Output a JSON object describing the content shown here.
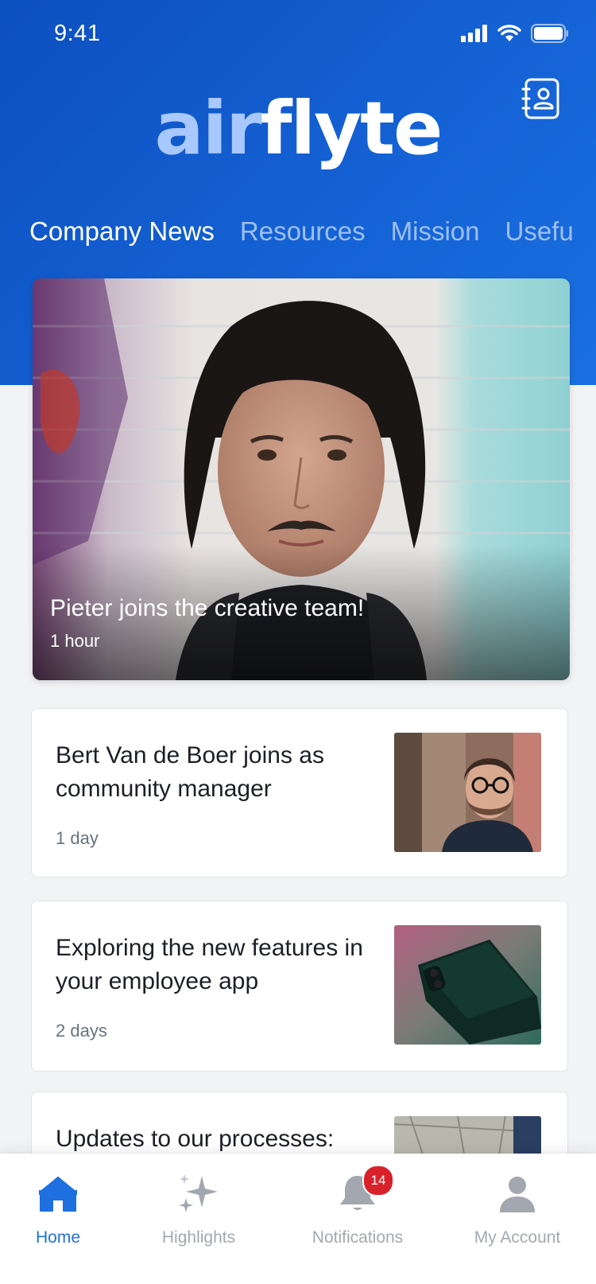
{
  "status_bar": {
    "time": "9:41"
  },
  "header": {
    "logo_part1": "air",
    "logo_part2": "flyte",
    "tabs": [
      {
        "label": "Company News",
        "active": true
      },
      {
        "label": "Resources"
      },
      {
        "label": "Mission"
      },
      {
        "label": "Usefu"
      }
    ]
  },
  "hero": {
    "title": "Pieter joins the creative team!",
    "time": "1 hour"
  },
  "cards": [
    {
      "title": "Bert Van de Boer joins as community manager",
      "time": "1 day"
    },
    {
      "title": "Exploring the new features in your employee app",
      "time": "2 days"
    },
    {
      "title": "Updates to our processes:",
      "time": ""
    }
  ],
  "tabbar": {
    "items": [
      {
        "label": "Home",
        "icon": "home-icon",
        "active": true
      },
      {
        "label": "Highlights",
        "icon": "sparkle-icon"
      },
      {
        "label": "Notifications",
        "icon": "bell-icon",
        "badge": "14"
      },
      {
        "label": "My Account",
        "icon": "user-icon"
      }
    ]
  },
  "colors": {
    "header_blue": "#1563d6",
    "active_tab": "#1e6fe0",
    "badge_red": "#d8212a"
  }
}
